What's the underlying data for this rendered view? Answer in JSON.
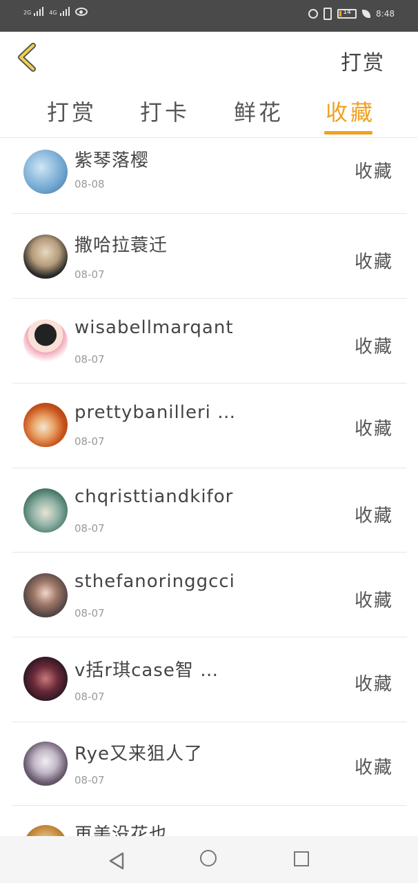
{
  "status_bar": {
    "network1": "2G",
    "network2": "4G",
    "battery": "14",
    "battery_level": 0.14,
    "time": "8:48"
  },
  "header": {
    "back_icon": "chevron-left-icon",
    "title": "打赏",
    "accent_color": "#f0a020"
  },
  "tabs": [
    {
      "label": "打赏",
      "active": false
    },
    {
      "label": "打卡",
      "active": false
    },
    {
      "label": "鲜花",
      "active": false
    },
    {
      "label": "收藏",
      "active": true
    }
  ],
  "list": [
    {
      "name": "紫琴落樱",
      "date": "08-08",
      "action": "收藏"
    },
    {
      "name": "撒哈拉蓑迁",
      "date": "08-07",
      "action": "收藏"
    },
    {
      "name": "wisabellmarqant",
      "date": "08-07",
      "action": "收藏"
    },
    {
      "name": "prettybanilleri …",
      "date": "08-07",
      "action": "收藏"
    },
    {
      "name": "chqristtiandkifor",
      "date": "08-07",
      "action": "收藏"
    },
    {
      "name": "sthefanoringgcci",
      "date": "08-07",
      "action": "收藏"
    },
    {
      "name": "v括r琪case智 …",
      "date": "08-07",
      "action": "收藏"
    },
    {
      "name": "Rye又来狙人了",
      "date": "08-07",
      "action": "收藏"
    },
    {
      "name": "再美没花也 …",
      "date": "",
      "action": ""
    }
  ],
  "nav": {
    "back_icon": "triangle-back-icon",
    "home_icon": "circle-home-icon",
    "recent_icon": "square-recent-icon"
  }
}
